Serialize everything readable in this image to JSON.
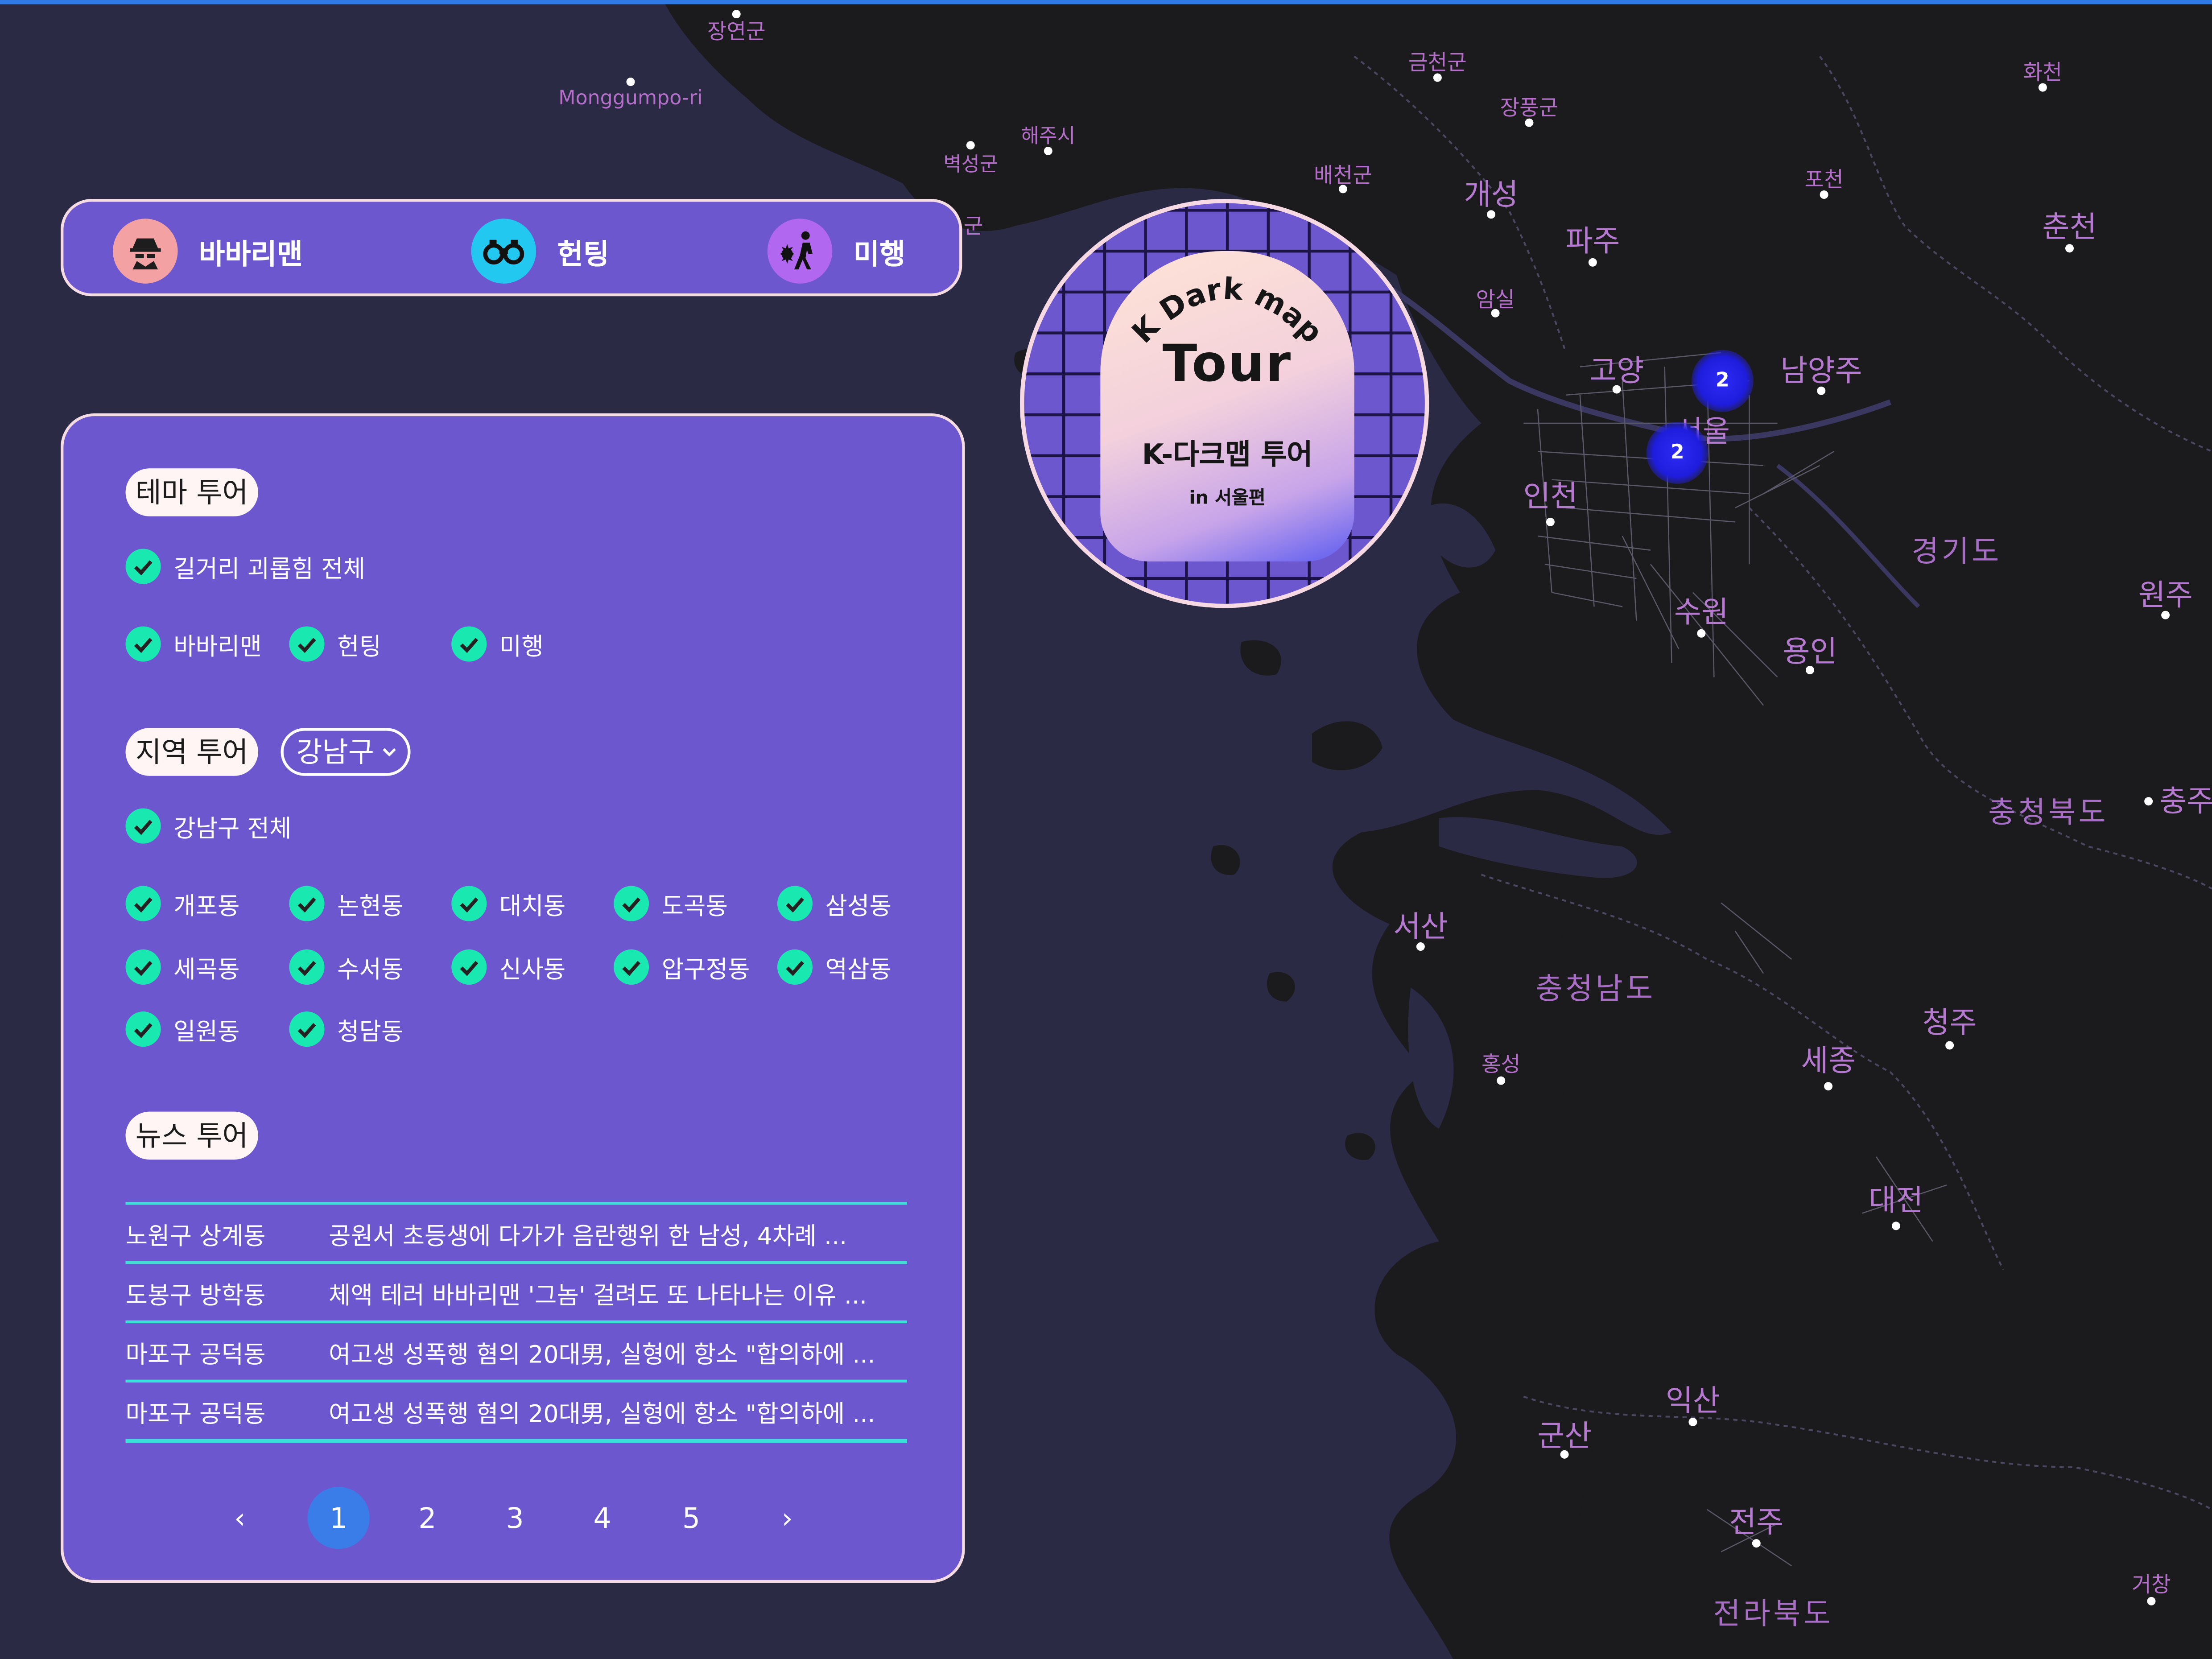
{
  "colors": {
    "accent": "#6d57cf",
    "check": "#19e9b0",
    "cluster": "#2d2bf5",
    "divider": "#3be0d6",
    "page_active": "#3b7de8",
    "place_label": "#b46fc9"
  },
  "filter_bar": {
    "items": [
      {
        "label": "바바리맨",
        "icon": "spy-icon",
        "icon_bg": "#f3a1a2"
      },
      {
        "label": "헌팅",
        "icon": "binoculars-icon",
        "icon_bg": "#22c8f0"
      },
      {
        "label": "미행",
        "icon": "walker-icon",
        "icon_bg": "#b267f0"
      }
    ]
  },
  "panel": {
    "theme": {
      "heading": "테마 투어",
      "all_label": "길거리 괴롭힘 전체",
      "options": [
        "바바리맨",
        "헌팅",
        "미행"
      ]
    },
    "region": {
      "heading": "지역 투어",
      "district_selected": "강남구",
      "all_label": "강남구 전체",
      "dongs": [
        "개포동",
        "논현동",
        "대치동",
        "도곡동",
        "삼성동",
        "세곡동",
        "수서동",
        "신사동",
        "압구정동",
        "역삼동",
        "일원동",
        "청담동"
      ]
    },
    "news": {
      "heading": "뉴스 투어",
      "rows": [
        {
          "location": "노원구 상계동",
          "title": "공원서 초등생에 다가가 음란행위 한 남성, 4차례 ..."
        },
        {
          "location": "도봉구 방학동",
          "title": "체액 테러 바바리맨 '그놈' 걸려도 또 나타나는 이유 ..."
        },
        {
          "location": "마포구 공덕동",
          "title": "여고생 성폭행 혐의 20대男, 실형에 항소 \"합의하에 ..."
        },
        {
          "location": "마포구 공덕동",
          "title": "여고생 성폭행 혐의 20대男, 실형에 항소 \"합의하에 ..."
        }
      ]
    },
    "pagination": {
      "prev": "‹",
      "next": "›",
      "pages": [
        "1",
        "2",
        "3",
        "4",
        "5"
      ],
      "current": "1"
    }
  },
  "badge": {
    "arc_text": "K Dark map",
    "title": "Tour",
    "subtitle": "K-다크맵 투어",
    "caption": "in 서울편"
  },
  "map": {
    "clusters": [
      {
        "count": "2"
      },
      {
        "count": "2"
      }
    ],
    "places": [
      "장연군",
      "Monggumpo-ri",
      "해주시",
      "벽성군",
      "군",
      "금천군",
      "장풍군",
      "배천군",
      "개성",
      "파주",
      "포천",
      "화천",
      "춘천",
      "암실",
      "고양",
      "남양주",
      "인천",
      "서울",
      "경기도",
      "원주",
      "수원",
      "용인",
      "충청북도",
      "충주",
      "서산",
      "충청남도",
      "홍성",
      "세종",
      "청주",
      "대전",
      "익산",
      "군산",
      "전주",
      "전라북도",
      "거창"
    ]
  }
}
